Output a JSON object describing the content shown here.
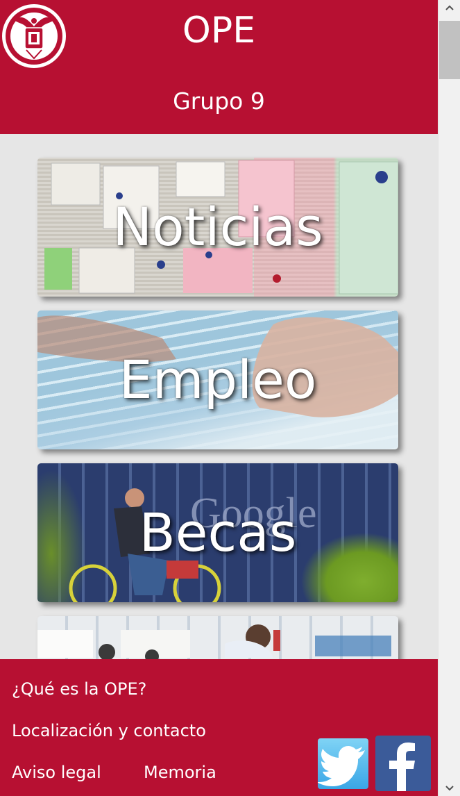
{
  "header": {
    "title": "OPE",
    "subtitle": "Grupo 9",
    "logo_icon": "university-crest-logo-icon"
  },
  "cards": [
    {
      "label": "Noticias"
    },
    {
      "label": "Empleo"
    },
    {
      "label": "Becas"
    },
    {
      "label": ""
    }
  ],
  "footer": {
    "links": [
      {
        "label": "¿Qué es la OPE?"
      },
      {
        "label": "Localización y contacto"
      },
      {
        "label": "Aviso legal"
      },
      {
        "label": "Memoria"
      }
    ],
    "social": {
      "twitter_icon": "twitter-bird-icon",
      "facebook_icon": "facebook-f-icon"
    }
  },
  "colors": {
    "brand": "#b71032",
    "background": "#e6e6e6",
    "text_on_brand": "#ffffff"
  }
}
